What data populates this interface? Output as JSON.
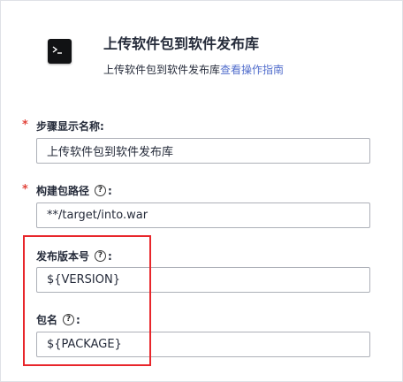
{
  "header": {
    "title": "上传软件包到软件发布库",
    "subtitle": "上传软件包到软件发布库",
    "guide_link": "查看操作指南",
    "icon": "terminal-icon"
  },
  "fields": [
    {
      "label": "步骤显示名称:",
      "required": true,
      "help": false,
      "value": "上传软件包到软件发布库"
    },
    {
      "label": "构建包路径",
      "required": true,
      "help": true,
      "value": "**/target/into.war"
    },
    {
      "label": "发布版本号",
      "required": false,
      "help": true,
      "value": "${VERSION}"
    },
    {
      "label": "包名",
      "required": false,
      "help": true,
      "value": "${PACKAGE}"
    }
  ],
  "symbols": {
    "required_mark": "*",
    "help_glyph": "?",
    "colon": ":"
  },
  "colors": {
    "accent_link": "#526ecc",
    "required": "#e2453c",
    "highlight": "#e8262b"
  }
}
